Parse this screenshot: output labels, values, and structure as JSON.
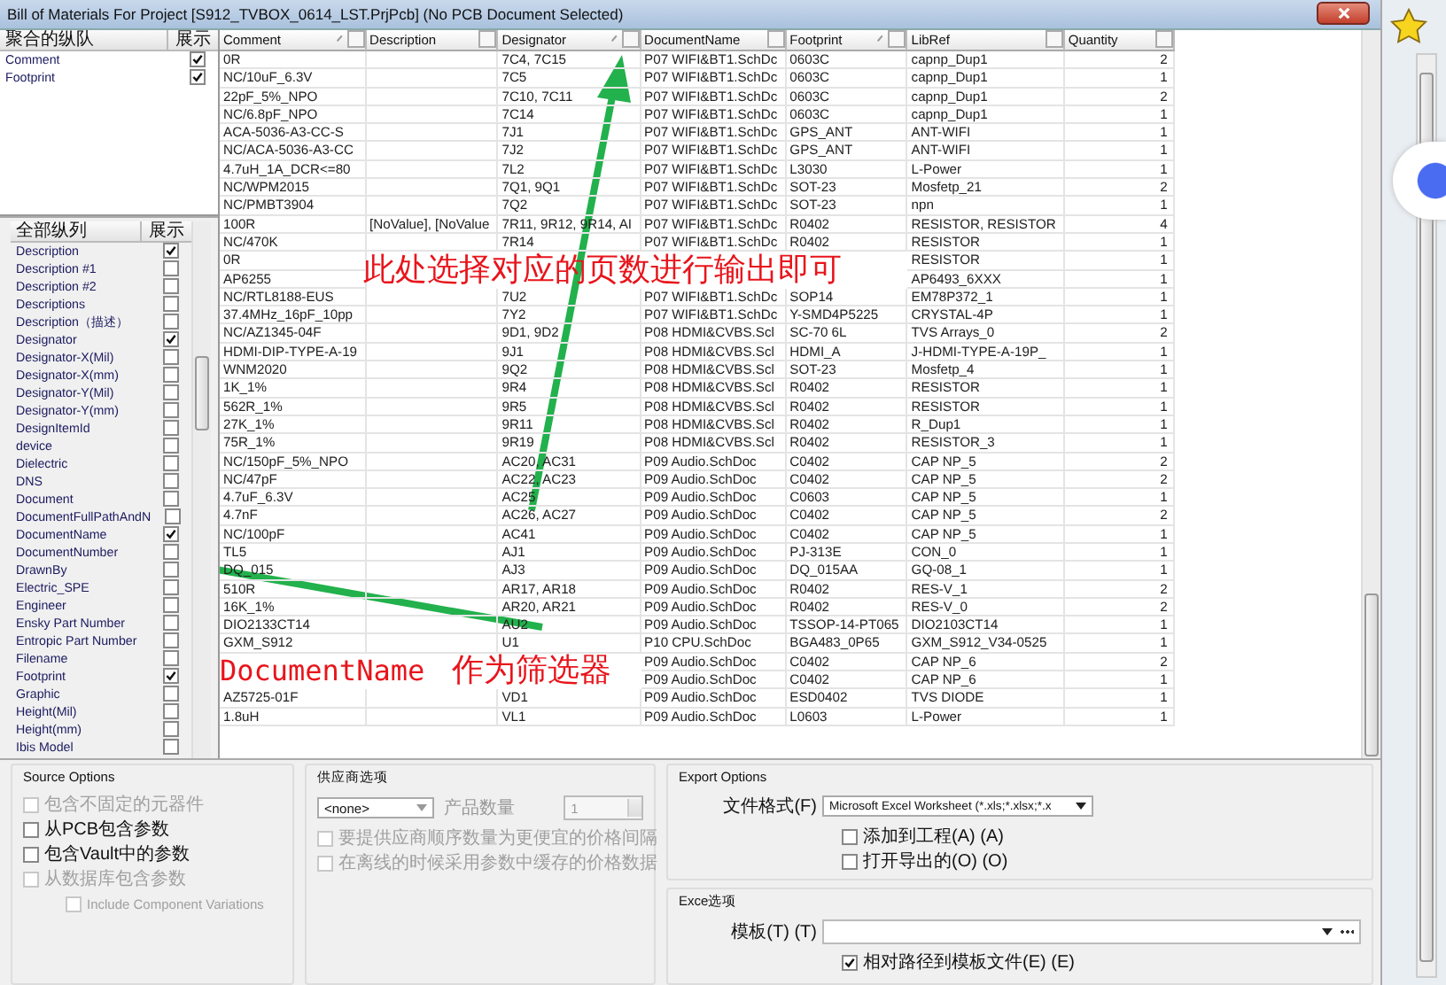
{
  "window": {
    "title": "Bill of Materials For Project [S912_TVBOX_0614_LST.PrjPcb] (No PCB Document Selected)"
  },
  "grouped_columns": {
    "header": "聚合的纵队",
    "show_header": "展示",
    "items": [
      {
        "label": "Comment",
        "checked": true
      },
      {
        "label": "Footprint",
        "checked": true
      }
    ]
  },
  "all_columns": {
    "header": "全部纵列",
    "show_header": "展示",
    "items": [
      {
        "label": "Description",
        "checked": true
      },
      {
        "label": "Description #1",
        "checked": false
      },
      {
        "label": "Description #2",
        "checked": false
      },
      {
        "label": "Descriptions",
        "checked": false
      },
      {
        "label": "Description（描述）",
        "checked": false
      },
      {
        "label": "Designator",
        "checked": true
      },
      {
        "label": "Designator-X(Mil)",
        "checked": false
      },
      {
        "label": "Designator-X(mm)",
        "checked": false
      },
      {
        "label": "Designator-Y(Mil)",
        "checked": false
      },
      {
        "label": "Designator-Y(mm)",
        "checked": false
      },
      {
        "label": "DesignItemId",
        "checked": false
      },
      {
        "label": "device",
        "checked": false
      },
      {
        "label": "Dielectric",
        "checked": false
      },
      {
        "label": "DNS",
        "checked": false
      },
      {
        "label": "Document",
        "checked": false
      },
      {
        "label": "DocumentFullPathAndN",
        "checked": false
      },
      {
        "label": "DocumentName",
        "checked": true
      },
      {
        "label": "DocumentNumber",
        "checked": false
      },
      {
        "label": "DrawnBy",
        "checked": false
      },
      {
        "label": "Electric_SPE",
        "checked": false
      },
      {
        "label": "Engineer",
        "checked": false
      },
      {
        "label": "Ensky Part Number",
        "checked": false
      },
      {
        "label": "Entropic Part Number",
        "checked": false
      },
      {
        "label": "Filename",
        "checked": false
      },
      {
        "label": "Footprint",
        "checked": true
      },
      {
        "label": "Graphic",
        "checked": false
      },
      {
        "label": "Height(Mil)",
        "checked": false
      },
      {
        "label": "Height(mm)",
        "checked": false
      },
      {
        "label": "Ibis Model",
        "checked": false
      }
    ]
  },
  "table": {
    "columns": [
      {
        "label": "Comment",
        "sortable": true
      },
      {
        "label": "Description",
        "sortable": false
      },
      {
        "label": "Designator",
        "sortable": true
      },
      {
        "label": "DocumentName",
        "sortable": false
      },
      {
        "label": "Footprint",
        "sortable": true
      },
      {
        "label": "LibRef",
        "sortable": false
      },
      {
        "label": "Quantity",
        "sortable": false
      }
    ],
    "rows": [
      [
        "0R",
        "",
        "7C4, 7C15",
        "P07 WIFI&BT1.SchDc",
        "0603C",
        "capnp_Dup1",
        "2"
      ],
      [
        "NC/10uF_6.3V",
        "",
        "7C5",
        "P07 WIFI&BT1.SchDc",
        "0603C",
        "capnp_Dup1",
        "1"
      ],
      [
        "22pF_5%_NPO",
        "",
        "7C10, 7C11",
        "P07 WIFI&BT1.SchDc",
        "0603C",
        "capnp_Dup1",
        "2"
      ],
      [
        "NC/6.8pF_NPO",
        "",
        "7C14",
        "P07 WIFI&BT1.SchDc",
        "0603C",
        "capnp_Dup1",
        "1"
      ],
      [
        "ACA-5036-A3-CC-S",
        "",
        "7J1",
        "P07 WIFI&BT1.SchDc",
        "GPS_ANT",
        "ANT-WIFI",
        "1"
      ],
      [
        "NC/ACA-5036-A3-CC",
        "",
        "7J2",
        "P07 WIFI&BT1.SchDc",
        "GPS_ANT",
        "ANT-WIFI",
        "1"
      ],
      [
        "4.7uH_1A_DCR<=80",
        "",
        "7L2",
        "P07 WIFI&BT1.SchDc",
        "L3030",
        "L-Power",
        "1"
      ],
      [
        "NC/WPM2015",
        "",
        "7Q1, 9Q1",
        "P07 WIFI&BT1.SchDc",
        "SOT-23",
        "Mosfetp_21",
        "2"
      ],
      [
        "NC/PMBT3904",
        "",
        "7Q2",
        "P07 WIFI&BT1.SchDc",
        "SOT-23",
        "npn",
        "1"
      ],
      [
        "100R",
        "[NoValue], [NoValue",
        "7R11, 9R12, 9R14, AI",
        "P07 WIFI&BT1.SchDc",
        "R0402",
        "RESISTOR, RESISTOR",
        "4"
      ],
      [
        "NC/470K",
        "",
        "7R14",
        "P07 WIFI&BT1.SchDc",
        "R0402",
        "RESISTOR",
        "1"
      ],
      [
        "0R",
        null,
        null,
        null,
        null,
        "RESISTOR",
        "1"
      ],
      [
        "AP6255",
        null,
        null,
        null,
        null,
        "AP6493_6XXX",
        "1"
      ],
      [
        "NC/RTL8188-EUS",
        "",
        "7U2",
        "P07 WIFI&BT1.SchDc",
        "SOP14",
        "EM78P372_1",
        "1"
      ],
      [
        "37.4MHz_16pF_10pp",
        "",
        "7Y2",
        "P07 WIFI&BT1.SchDc",
        "Y-SMD4P5225",
        "CRYSTAL-4P",
        "1"
      ],
      [
        "NC/AZ1345-04F",
        "",
        "9D1, 9D2",
        "P08 HDMI&CVBS.Scl",
        "SC-70 6L",
        "TVS Arrays_0",
        "2"
      ],
      [
        "HDMI-DIP-TYPE-A-19",
        "",
        "9J1",
        "P08 HDMI&CVBS.Scl",
        "HDMI_A",
        "J-HDMI-TYPE-A-19P_",
        "1"
      ],
      [
        "WNM2020",
        "",
        "9Q2",
        "P08 HDMI&CVBS.Scl",
        "SOT-23",
        "Mosfetp_4",
        "1"
      ],
      [
        "1K_1%",
        "",
        "9R4",
        "P08 HDMI&CVBS.Scl",
        "R0402",
        "RESISTOR",
        "1"
      ],
      [
        "562R_1%",
        "",
        "9R5",
        "P08 HDMI&CVBS.Scl",
        "R0402",
        "RESISTOR",
        "1"
      ],
      [
        "27K_1%",
        "",
        "9R11",
        "P08 HDMI&CVBS.Scl",
        "R0402",
        "R_Dup1",
        "1"
      ],
      [
        "75R_1%",
        "",
        "9R19",
        "P08 HDMI&CVBS.Scl",
        "R0402",
        "RESISTOR_3",
        "1"
      ],
      [
        "NC/150pF_5%_NPO",
        "",
        "AC20, AC31",
        "P09 Audio.SchDoc",
        "C0402",
        "CAP NP_5",
        "2"
      ],
      [
        "NC/47pF",
        "",
        "AC22, AC23",
        "P09 Audio.SchDoc",
        "C0402",
        "CAP NP_5",
        "2"
      ],
      [
        "4.7uF_6.3V",
        "",
        "AC25",
        "P09 Audio.SchDoc",
        "C0603",
        "CAP NP_5",
        "1"
      ],
      [
        "4.7nF",
        "",
        "AC26, AC27",
        "P09 Audio.SchDoc",
        "C0402",
        "CAP NP_5",
        "2"
      ],
      [
        "NC/100pF",
        "",
        "AC41",
        "P09 Audio.SchDoc",
        "C0402",
        "CAP NP_5",
        "1"
      ],
      [
        "TL5",
        "",
        "AJ1",
        "P09 Audio.SchDoc",
        "PJ-313E",
        "CON_0",
        "1"
      ],
      [
        "DQ_015",
        "",
        "AJ3",
        "P09 Audio.SchDoc",
        "DQ_015AA",
        "GQ-08_1",
        "1"
      ],
      [
        "510R",
        "",
        "AR17, AR18",
        "P09 Audio.SchDoc",
        "R0402",
        "RES-V_1",
        "2"
      ],
      [
        "16K_1%",
        "",
        "AR20, AR21",
        "P09 Audio.SchDoc",
        "R0402",
        "RES-V_0",
        "2"
      ],
      [
        "DIO2133CT14",
        "",
        "AU2",
        "P09 Audio.SchDoc",
        "TSSOP-14-PT065",
        "DIO2103CT14",
        "1"
      ],
      [
        "GXM_S912",
        "",
        "U1",
        "P10 CPU.SchDoc",
        "BGA483_0P65",
        "GXM_S912_V34-0525",
        "1"
      ],
      [
        null,
        null,
        null,
        "P09 Audio.SchDoc",
        "C0402",
        "CAP NP_6",
        "2"
      ],
      [
        null,
        null,
        null,
        "P09 Audio.SchDoc",
        "C0402",
        "CAP NP_6",
        "1"
      ],
      [
        "AZ5725-01F",
        "",
        "VD1",
        "P09 Audio.SchDoc",
        "ESD0402",
        "TVS DIODE",
        "1"
      ],
      [
        "1.8uH",
        "",
        "VL1",
        "P09 Audio.SchDoc",
        "L0603",
        "L-Power",
        "1"
      ]
    ]
  },
  "source_options": {
    "title": "Source Options",
    "options": [
      {
        "label": "包含不固定的元器件",
        "checked": false,
        "disabled": true
      },
      {
        "label": "从PCB包含参数",
        "checked": false,
        "disabled": false
      },
      {
        "label": "包含Vault中的参数",
        "checked": false,
        "disabled": false
      },
      {
        "label": "从数据库包含参数",
        "checked": false,
        "disabled": true,
        "children": [
          {
            "label": "Include Component Variations",
            "checked": false,
            "disabled": true
          }
        ]
      }
    ]
  },
  "supplier_options": {
    "title": "供应商选项",
    "source": {
      "value": "<none>"
    },
    "quantity_label": "产品数量",
    "quantity": {
      "value": "1",
      "disabled": true
    },
    "options": [
      {
        "label": "要提供应商顺序数量为更便宜的价格间隔",
        "checked": false,
        "disabled": true
      },
      {
        "label": "在离线的时候采用参数中缓存的价格数据",
        "checked": false,
        "disabled": true
      }
    ]
  },
  "export_options": {
    "title": "Export Options",
    "format_label": "文件格式(F)",
    "format": {
      "value": "Microsoft Excel Worksheet (*.xls;*.xlsx;*.x"
    },
    "options": [
      {
        "label": "添加到工程(A) (A)",
        "checked": false,
        "disabled": false
      },
      {
        "label": "打开导出的(O) (O)",
        "checked": false,
        "disabled": false
      }
    ]
  },
  "excel_options": {
    "title": "Exce选项",
    "template_label": "模板(T) (T)",
    "options": [
      {
        "label": "相对路径到模板文件(E) (E)",
        "checked": true,
        "disabled": false
      }
    ]
  },
  "annotations": [
    {
      "text": "此处选择对应的页数进行输出即可",
      "kind": "serif"
    },
    {
      "text": "DocumentName",
      "kind": "mono"
    },
    {
      "text": "作为筛选器",
      "kind": "serif"
    }
  ]
}
